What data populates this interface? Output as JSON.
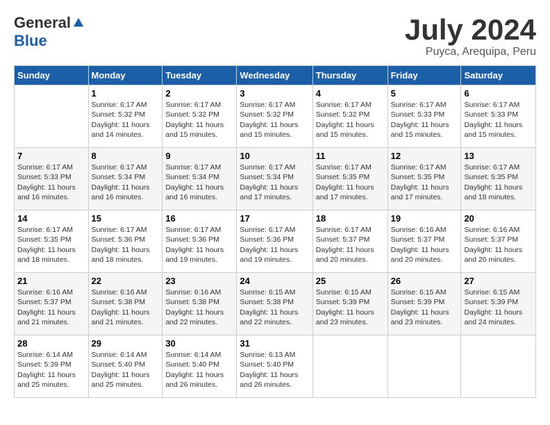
{
  "logo": {
    "general": "General",
    "blue": "Blue"
  },
  "title": "July 2024",
  "location": "Puyca, Arequipa, Peru",
  "days_of_week": [
    "Sunday",
    "Monday",
    "Tuesday",
    "Wednesday",
    "Thursday",
    "Friday",
    "Saturday"
  ],
  "weeks": [
    [
      {
        "day": "",
        "sunrise": "",
        "sunset": "",
        "daylight": ""
      },
      {
        "day": "1",
        "sunrise": "Sunrise: 6:17 AM",
        "sunset": "Sunset: 5:32 PM",
        "daylight": "Daylight: 11 hours and 14 minutes."
      },
      {
        "day": "2",
        "sunrise": "Sunrise: 6:17 AM",
        "sunset": "Sunset: 5:32 PM",
        "daylight": "Daylight: 11 hours and 15 minutes."
      },
      {
        "day": "3",
        "sunrise": "Sunrise: 6:17 AM",
        "sunset": "Sunset: 5:32 PM",
        "daylight": "Daylight: 11 hours and 15 minutes."
      },
      {
        "day": "4",
        "sunrise": "Sunrise: 6:17 AM",
        "sunset": "Sunset: 5:32 PM",
        "daylight": "Daylight: 11 hours and 15 minutes."
      },
      {
        "day": "5",
        "sunrise": "Sunrise: 6:17 AM",
        "sunset": "Sunset: 5:33 PM",
        "daylight": "Daylight: 11 hours and 15 minutes."
      },
      {
        "day": "6",
        "sunrise": "Sunrise: 6:17 AM",
        "sunset": "Sunset: 5:33 PM",
        "daylight": "Daylight: 11 hours and 15 minutes."
      }
    ],
    [
      {
        "day": "7",
        "sunrise": "Sunrise: 6:17 AM",
        "sunset": "Sunset: 5:33 PM",
        "daylight": "Daylight: 11 hours and 16 minutes."
      },
      {
        "day": "8",
        "sunrise": "Sunrise: 6:17 AM",
        "sunset": "Sunset: 5:34 PM",
        "daylight": "Daylight: 11 hours and 16 minutes."
      },
      {
        "day": "9",
        "sunrise": "Sunrise: 6:17 AM",
        "sunset": "Sunset: 5:34 PM",
        "daylight": "Daylight: 11 hours and 16 minutes."
      },
      {
        "day": "10",
        "sunrise": "Sunrise: 6:17 AM",
        "sunset": "Sunset: 5:34 PM",
        "daylight": "Daylight: 11 hours and 17 minutes."
      },
      {
        "day": "11",
        "sunrise": "Sunrise: 6:17 AM",
        "sunset": "Sunset: 5:35 PM",
        "daylight": "Daylight: 11 hours and 17 minutes."
      },
      {
        "day": "12",
        "sunrise": "Sunrise: 6:17 AM",
        "sunset": "Sunset: 5:35 PM",
        "daylight": "Daylight: 11 hours and 17 minutes."
      },
      {
        "day": "13",
        "sunrise": "Sunrise: 6:17 AM",
        "sunset": "Sunset: 5:35 PM",
        "daylight": "Daylight: 11 hours and 18 minutes."
      }
    ],
    [
      {
        "day": "14",
        "sunrise": "Sunrise: 6:17 AM",
        "sunset": "Sunset: 5:35 PM",
        "daylight": "Daylight: 11 hours and 18 minutes."
      },
      {
        "day": "15",
        "sunrise": "Sunrise: 6:17 AM",
        "sunset": "Sunset: 5:36 PM",
        "daylight": "Daylight: 11 hours and 18 minutes."
      },
      {
        "day": "16",
        "sunrise": "Sunrise: 6:17 AM",
        "sunset": "Sunset: 5:36 PM",
        "daylight": "Daylight: 11 hours and 19 minutes."
      },
      {
        "day": "17",
        "sunrise": "Sunrise: 6:17 AM",
        "sunset": "Sunset: 5:36 PM",
        "daylight": "Daylight: 11 hours and 19 minutes."
      },
      {
        "day": "18",
        "sunrise": "Sunrise: 6:17 AM",
        "sunset": "Sunset: 5:37 PM",
        "daylight": "Daylight: 11 hours and 20 minutes."
      },
      {
        "day": "19",
        "sunrise": "Sunrise: 6:16 AM",
        "sunset": "Sunset: 5:37 PM",
        "daylight": "Daylight: 11 hours and 20 minutes."
      },
      {
        "day": "20",
        "sunrise": "Sunrise: 6:16 AM",
        "sunset": "Sunset: 5:37 PM",
        "daylight": "Daylight: 11 hours and 20 minutes."
      }
    ],
    [
      {
        "day": "21",
        "sunrise": "Sunrise: 6:16 AM",
        "sunset": "Sunset: 5:37 PM",
        "daylight": "Daylight: 11 hours and 21 minutes."
      },
      {
        "day": "22",
        "sunrise": "Sunrise: 6:16 AM",
        "sunset": "Sunset: 5:38 PM",
        "daylight": "Daylight: 11 hours and 21 minutes."
      },
      {
        "day": "23",
        "sunrise": "Sunrise: 6:16 AM",
        "sunset": "Sunset: 5:38 PM",
        "daylight": "Daylight: 11 hours and 22 minutes."
      },
      {
        "day": "24",
        "sunrise": "Sunrise: 6:15 AM",
        "sunset": "Sunset: 5:38 PM",
        "daylight": "Daylight: 11 hours and 22 minutes."
      },
      {
        "day": "25",
        "sunrise": "Sunrise: 6:15 AM",
        "sunset": "Sunset: 5:39 PM",
        "daylight": "Daylight: 11 hours and 23 minutes."
      },
      {
        "day": "26",
        "sunrise": "Sunrise: 6:15 AM",
        "sunset": "Sunset: 5:39 PM",
        "daylight": "Daylight: 11 hours and 23 minutes."
      },
      {
        "day": "27",
        "sunrise": "Sunrise: 6:15 AM",
        "sunset": "Sunset: 5:39 PM",
        "daylight": "Daylight: 11 hours and 24 minutes."
      }
    ],
    [
      {
        "day": "28",
        "sunrise": "Sunrise: 6:14 AM",
        "sunset": "Sunset: 5:39 PM",
        "daylight": "Daylight: 11 hours and 25 minutes."
      },
      {
        "day": "29",
        "sunrise": "Sunrise: 6:14 AM",
        "sunset": "Sunset: 5:40 PM",
        "daylight": "Daylight: 11 hours and 25 minutes."
      },
      {
        "day": "30",
        "sunrise": "Sunrise: 6:14 AM",
        "sunset": "Sunset: 5:40 PM",
        "daylight": "Daylight: 11 hours and 26 minutes."
      },
      {
        "day": "31",
        "sunrise": "Sunrise: 6:13 AM",
        "sunset": "Sunset: 5:40 PM",
        "daylight": "Daylight: 11 hours and 26 minutes."
      },
      {
        "day": "",
        "sunrise": "",
        "sunset": "",
        "daylight": ""
      },
      {
        "day": "",
        "sunrise": "",
        "sunset": "",
        "daylight": ""
      },
      {
        "day": "",
        "sunrise": "",
        "sunset": "",
        "daylight": ""
      }
    ]
  ]
}
